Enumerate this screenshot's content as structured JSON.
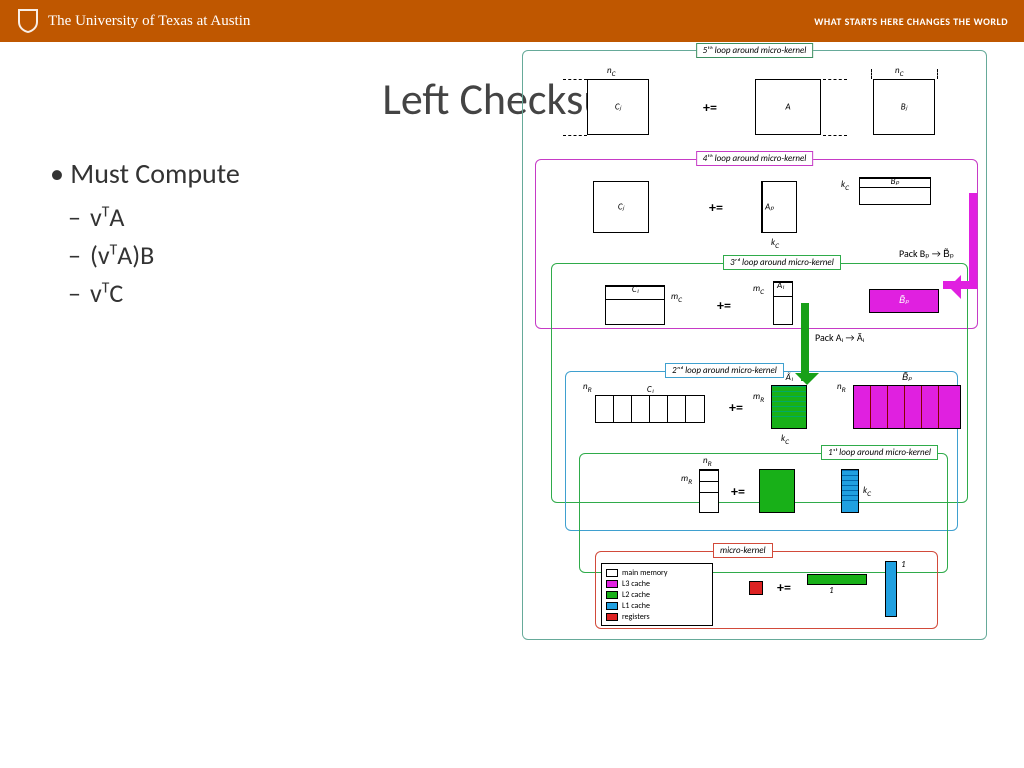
{
  "header": {
    "university": "The University of Texas at Austin",
    "tagline": "WHAT STARTS HERE CHANGES THE WORLD"
  },
  "slide": {
    "title": "Left Checksum",
    "bullet": "Must Compute",
    "subs": [
      "vᵀA",
      "(vᵀA)B",
      "vᵀC"
    ]
  },
  "diagram": {
    "loops": {
      "l5": "5ᵗʰ loop around micro-kernel",
      "l4": "4ᵗʰ loop around micro-kernel",
      "l3": "3ʳᵈ loop around micro-kernel",
      "l2": "2ⁿᵈ loop around micro-kernel",
      "l1": "1ˢᵗ loop around micro-kernel",
      "mk": "micro-kernel"
    },
    "matrices": {
      "Cj": "Cⱼ",
      "A": "A",
      "Bj": "Bⱼ",
      "Ap": "Aₚ",
      "Bp": "Bₚ",
      "Btilde": "B̃ₚ",
      "Ci": "Cᵢ",
      "Ai": "Aᵢ",
      "Atilde": "Ãᵢ",
      "Btilde2": "B̃ₚ",
      "plus": "+="
    },
    "dims": {
      "nc": "n_C",
      "kc": "k_C",
      "mc": "m_C",
      "nr": "n_R",
      "mr": "m_R",
      "one": "1"
    },
    "pack": {
      "bp": "Pack Bₚ → B̃ₚ",
      "ai": "Pack Aᵢ → Ãᵢ"
    },
    "legend": {
      "title": "",
      "items": [
        {
          "color": "#ffffff",
          "label": "main memory"
        },
        {
          "color": "#e020e0",
          "label": "L3 cache"
        },
        {
          "color": "#18b018",
          "label": "L2 cache"
        },
        {
          "color": "#20a0e0",
          "label": "L1 cache"
        },
        {
          "color": "#d22222",
          "label": "registers"
        }
      ]
    }
  }
}
